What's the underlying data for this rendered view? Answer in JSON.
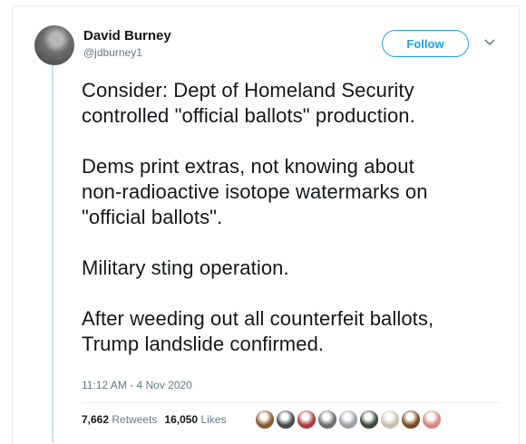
{
  "tweet": {
    "author_name": "David Burney",
    "author_handle": "@jdburney1",
    "follow_label": "Follow",
    "paragraphs": [
      "Consider: Dept of Homeland Security\ncontrolled \"official ballots\" production.",
      "Dems print extras, not knowing about\nnon-radioactive isotope watermarks on\n\"official ballots\".",
      "Military sting operation.",
      "After weeding out all counterfeit ballots,\nTrump landslide confirmed."
    ],
    "timestamp": "11:12 AM - 4 Nov 2020",
    "retweets_count": "7,662",
    "retweets_label": "Retweets",
    "likes_count": "16,050",
    "likes_label": "Likes"
  },
  "icons": {
    "more": "chevron-down-icon"
  },
  "colors": {
    "accent": "#1da1f2",
    "text": "#14171a",
    "muted": "#657786",
    "thread_line": "#c4e3f7",
    "likers": [
      "#8a5a2b",
      "#4a4a4a",
      "#b03a3a",
      "#6d6d6d",
      "#9aa0a6",
      "#3b4a3b",
      "#c9c0a8",
      "#7a4a22",
      "#d28a7c"
    ]
  }
}
